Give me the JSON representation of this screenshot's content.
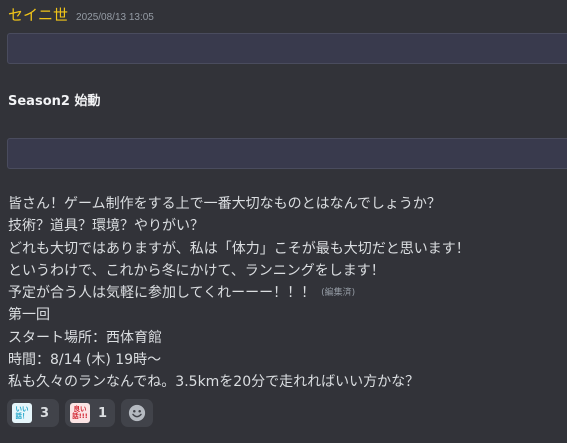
{
  "message": {
    "author": "セイニ世",
    "timestamp": "2025/08/13 13:05",
    "heading": "Season2 始動",
    "lines": [
      "皆さん！ゲーム制作をする上で一番大切なものとはなんでしょうか？",
      "技術？道具？環境？やりがい？",
      "どれも大切ではありますが、私は「体力」こそが最も大切だと思います！",
      "というわけで、これから冬にかけて、ランニングをします！",
      "予定が合う人は気軽に参加してくれーーー！！！",
      "第一回",
      "スタート場所：西体育館",
      "時間：8/14 (木) 19時～",
      "私も久々のランなんでね。3.5kmを20分で走れればいい方かな？"
    ],
    "edited_label": "(編集済)"
  },
  "reactions": [
    {
      "stamp_top": "いい",
      "stamp_bottom": "話！",
      "count": "3"
    },
    {
      "stamp_top": "良い",
      "stamp_bottom": "話!!!",
      "count": "1"
    }
  ],
  "icons": {
    "stamp1": "good-story-sticker-icon",
    "stamp2": "good-story-red-sticker-icon",
    "add": "smiley-add-reaction-icon"
  },
  "colors": {
    "author": "#f0c419",
    "background": "#323339",
    "bar": "#393a4d"
  }
}
